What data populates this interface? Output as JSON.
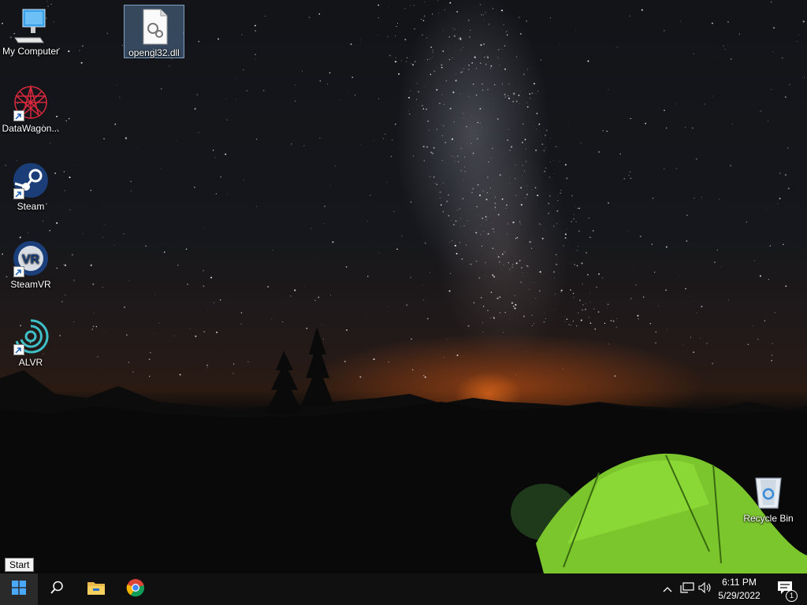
{
  "desktop": {
    "icons": [
      {
        "label": "My Computer"
      },
      {
        "label": "opengl32.dll"
      },
      {
        "label": "DataWagon..."
      },
      {
        "label": "Steam"
      },
      {
        "label": "SteamVR"
      },
      {
        "label": "ALVR"
      },
      {
        "label": "Recycle Bin"
      }
    ],
    "vr_badge": "VR"
  },
  "tooltip": {
    "text": "Start"
  },
  "taskbar": {
    "start_icon": "windows-logo-icon",
    "search_icon": "search-icon",
    "pinned": [
      "file-explorer-icon",
      "chrome-icon"
    ],
    "tray": {
      "time": "6:11 PM",
      "date": "5/29/2022",
      "notification_count": "1"
    }
  }
}
